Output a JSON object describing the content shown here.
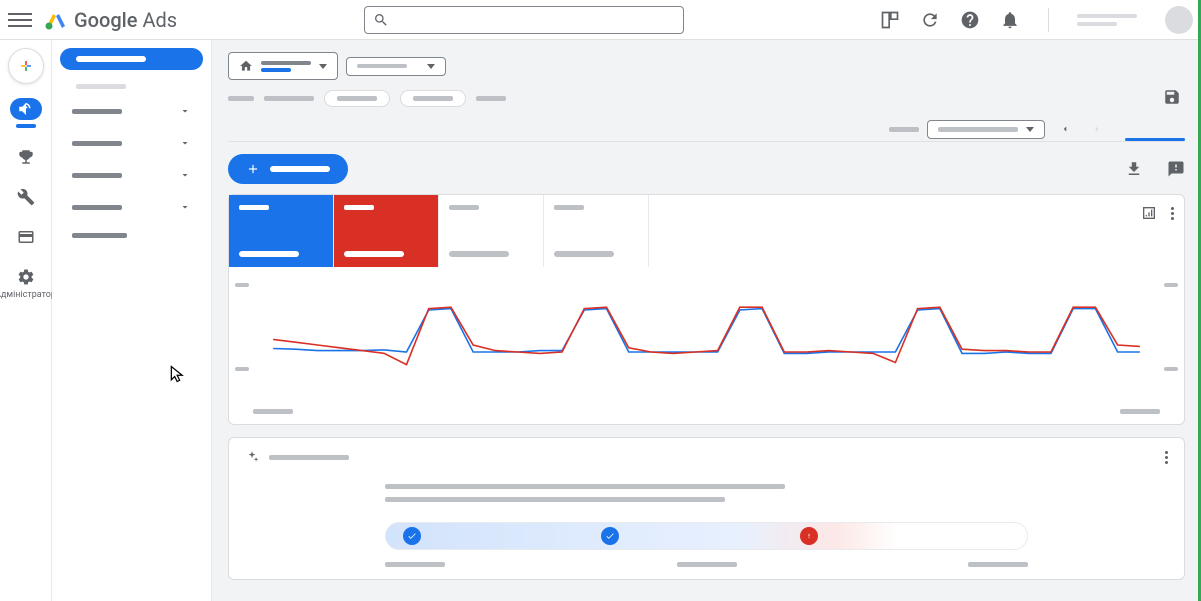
{
  "header": {
    "product_name": "Google",
    "product_suffix": "Ads",
    "search_placeholder": ""
  },
  "left_rail": {
    "admin_label": "Адміністратор"
  },
  "chart_data": {
    "type": "line",
    "x": [
      0,
      1,
      2,
      3,
      4,
      5,
      6,
      7,
      8,
      9,
      10,
      11,
      12,
      13,
      14,
      15,
      16,
      17,
      18,
      19,
      20,
      21,
      22,
      23,
      24,
      25,
      26,
      27,
      28,
      29,
      30,
      31,
      32,
      33,
      34,
      35,
      36,
      37,
      38,
      39
    ],
    "series": [
      {
        "name": "metric_blue",
        "color": "#1a73e8",
        "values": [
          35,
          34,
          32,
          32,
          32,
          33,
          30,
          90,
          92,
          30,
          30,
          30,
          32,
          32,
          90,
          92,
          30,
          30,
          30,
          30,
          30,
          90,
          92,
          28,
          28,
          30,
          30,
          30,
          30,
          90,
          92,
          28,
          28,
          30,
          28,
          28,
          92,
          92,
          30,
          30
        ]
      },
      {
        "name": "metric_red",
        "color": "#d93025",
        "values": [
          48,
          44,
          40,
          36,
          32,
          28,
          12,
          92,
          94,
          40,
          32,
          30,
          28,
          30,
          92,
          94,
          36,
          30,
          28,
          30,
          32,
          94,
          94,
          30,
          30,
          32,
          30,
          28,
          15,
          92,
          94,
          34,
          32,
          32,
          30,
          30,
          94,
          94,
          40,
          38
        ]
      }
    ],
    "ylim": [
      0,
      100
    ]
  },
  "progress": {
    "steps": [
      {
        "pos": 4,
        "state": "check"
      },
      {
        "pos": 35,
        "state": "check"
      },
      {
        "pos": 66,
        "state": "warn"
      }
    ]
  }
}
